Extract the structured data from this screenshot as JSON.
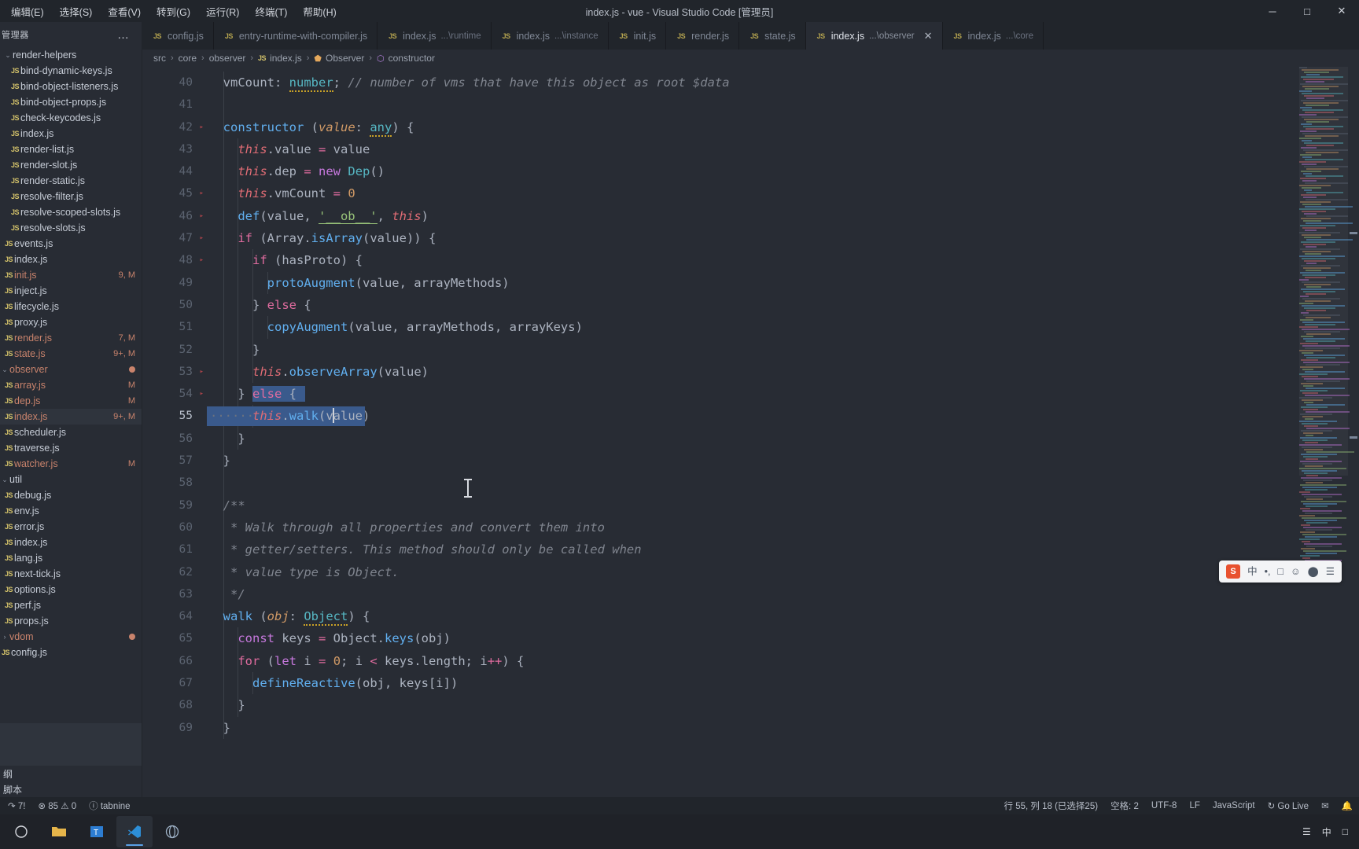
{
  "window": {
    "title": "index.js - vue - Visual Studio Code [管理员]",
    "menu": [
      "编辑(E)",
      "选择(S)",
      "查看(V)",
      "转到(G)",
      "运行(R)",
      "终端(T)",
      "帮助(H)"
    ],
    "controls": {
      "minimize": "─",
      "maximize": "□",
      "close": "✕"
    }
  },
  "sidebar": {
    "title": "管理器",
    "more_label": "…",
    "items": [
      {
        "label": "render-helpers",
        "type": "folder",
        "expanded": true,
        "indent": 1,
        "badge": ""
      },
      {
        "label": "bind-dynamic-keys.js",
        "type": "js",
        "indent": 2,
        "badge": ""
      },
      {
        "label": "bind-object-listeners.js",
        "type": "js",
        "indent": 2,
        "badge": ""
      },
      {
        "label": "bind-object-props.js",
        "type": "js",
        "indent": 2,
        "badge": ""
      },
      {
        "label": "check-keycodes.js",
        "type": "js",
        "indent": 2,
        "badge": ""
      },
      {
        "label": "index.js",
        "type": "js",
        "indent": 2,
        "badge": ""
      },
      {
        "label": "render-list.js",
        "type": "js",
        "indent": 2,
        "badge": ""
      },
      {
        "label": "render-slot.js",
        "type": "js",
        "indent": 2,
        "badge": ""
      },
      {
        "label": "render-static.js",
        "type": "js",
        "indent": 2,
        "badge": ""
      },
      {
        "label": "resolve-filter.js",
        "type": "js",
        "indent": 2,
        "badge": ""
      },
      {
        "label": "resolve-scoped-slots.js",
        "type": "js",
        "indent": 2,
        "badge": ""
      },
      {
        "label": "resolve-slots.js",
        "type": "js",
        "indent": 2,
        "badge": ""
      },
      {
        "label": "events.js",
        "type": "js",
        "indent": 1,
        "badge": ""
      },
      {
        "label": "index.js",
        "type": "js",
        "indent": 1,
        "badge": ""
      },
      {
        "label": "init.js",
        "type": "js",
        "indent": 1,
        "badge": "9, M",
        "modified": true
      },
      {
        "label": "inject.js",
        "type": "js",
        "indent": 1,
        "badge": ""
      },
      {
        "label": "lifecycle.js",
        "type": "js",
        "indent": 1,
        "badge": ""
      },
      {
        "label": "proxy.js",
        "type": "js",
        "indent": 1,
        "badge": ""
      },
      {
        "label": "render.js",
        "type": "js",
        "indent": 1,
        "badge": "7, M",
        "modified": true
      },
      {
        "label": "state.js",
        "type": "js",
        "indent": 1,
        "badge": "9+, M",
        "modified": true
      },
      {
        "label": "observer",
        "type": "folder",
        "expanded": true,
        "indent": 0,
        "badge": "dot",
        "modified": true
      },
      {
        "label": "array.js",
        "type": "js",
        "indent": 1,
        "badge": "M",
        "modified": true
      },
      {
        "label": "dep.js",
        "type": "js",
        "indent": 1,
        "badge": "M",
        "modified": true
      },
      {
        "label": "index.js",
        "type": "js",
        "indent": 1,
        "badge": "9+, M",
        "modified": true,
        "selected": true
      },
      {
        "label": "scheduler.js",
        "type": "js",
        "indent": 1,
        "badge": ""
      },
      {
        "label": "traverse.js",
        "type": "js",
        "indent": 1,
        "badge": ""
      },
      {
        "label": "watcher.js",
        "type": "js",
        "indent": 1,
        "badge": "M",
        "modified": true
      },
      {
        "label": "util",
        "type": "folder",
        "expanded": true,
        "indent": 0,
        "badge": ""
      },
      {
        "label": "debug.js",
        "type": "js",
        "indent": 1,
        "badge": ""
      },
      {
        "label": "env.js",
        "type": "js",
        "indent": 1,
        "badge": ""
      },
      {
        "label": "error.js",
        "type": "js",
        "indent": 1,
        "badge": ""
      },
      {
        "label": "index.js",
        "type": "js",
        "indent": 1,
        "badge": ""
      },
      {
        "label": "lang.js",
        "type": "js",
        "indent": 1,
        "badge": ""
      },
      {
        "label": "next-tick.js",
        "type": "js",
        "indent": 1,
        "badge": ""
      },
      {
        "label": "options.js",
        "type": "js",
        "indent": 1,
        "badge": ""
      },
      {
        "label": "perf.js",
        "type": "js",
        "indent": 1,
        "badge": ""
      },
      {
        "label": "props.js",
        "type": "js",
        "indent": 1,
        "badge": ""
      },
      {
        "label": "vdom",
        "type": "folder",
        "expanded": false,
        "indent": 0,
        "badge": "dot",
        "modified": true
      },
      {
        "label": "config.js",
        "type": "js",
        "indent": 0,
        "badge": ""
      }
    ],
    "bottom_sections": [
      "纲",
      "脚本"
    ]
  },
  "tabs": [
    {
      "label": "config.js",
      "sub": "",
      "active": false
    },
    {
      "label": "entry-runtime-with-compiler.js",
      "sub": "",
      "active": false
    },
    {
      "label": "index.js",
      "sub": "...\\runtime",
      "active": false
    },
    {
      "label": "index.js",
      "sub": "...\\instance",
      "active": false
    },
    {
      "label": "init.js",
      "sub": "",
      "active": false
    },
    {
      "label": "render.js",
      "sub": "",
      "active": false
    },
    {
      "label": "state.js",
      "sub": "",
      "active": false
    },
    {
      "label": "index.js",
      "sub": "...\\observer",
      "active": true,
      "close": "✕"
    },
    {
      "label": "index.js",
      "sub": "...\\core",
      "active": false
    }
  ],
  "breadcrumb": [
    {
      "label": "src",
      "icon": ""
    },
    {
      "label": "core",
      "icon": ""
    },
    {
      "label": "observer",
      "icon": ""
    },
    {
      "label": "index.js",
      "icon": "js-icon"
    },
    {
      "label": "Observer",
      "icon": "class-icon"
    },
    {
      "label": "constructor",
      "icon": "method-icon"
    }
  ],
  "editor": {
    "first_line": 40,
    "current_line": 55,
    "lines": [
      {
        "n": 40,
        "fold": false,
        "indent": 1,
        "tokens": [
          {
            "t": "  ",
            "c": "plain"
          },
          {
            "t": "vmCount",
            "c": "prop"
          },
          {
            "t": ": ",
            "c": "punct"
          },
          {
            "t": "number",
            "c": "type",
            "squiggle": true
          },
          {
            "t": "; ",
            "c": "punct"
          },
          {
            "t": "// number of vms that have this object as root $data",
            "c": "cmt"
          }
        ]
      },
      {
        "n": 41,
        "fold": false,
        "indent": 1,
        "tokens": []
      },
      {
        "n": 42,
        "fold": true,
        "indent": 1,
        "tokens": [
          {
            "t": "  ",
            "c": "plain"
          },
          {
            "t": "constructor",
            "c": "fnname"
          },
          {
            "t": " (",
            "c": "punct"
          },
          {
            "t": "value",
            "c": "param"
          },
          {
            "t": ": ",
            "c": "punct"
          },
          {
            "t": "any",
            "c": "type",
            "squiggle": true
          },
          {
            "t": ") {",
            "c": "punct"
          }
        ]
      },
      {
        "n": 43,
        "fold": false,
        "indent": 2,
        "tokens": [
          {
            "t": "    ",
            "c": "plain"
          },
          {
            "t": "this",
            "c": "var"
          },
          {
            "t": ".value ",
            "c": "prop"
          },
          {
            "t": "=",
            "c": "kw2"
          },
          {
            "t": " value",
            "c": "prop"
          }
        ]
      },
      {
        "n": 44,
        "fold": false,
        "indent": 2,
        "tokens": [
          {
            "t": "    ",
            "c": "plain"
          },
          {
            "t": "this",
            "c": "var"
          },
          {
            "t": ".dep ",
            "c": "prop"
          },
          {
            "t": "=",
            "c": "kw2"
          },
          {
            "t": " ",
            "c": "plain"
          },
          {
            "t": "new",
            "c": "kw"
          },
          {
            "t": " ",
            "c": "plain"
          },
          {
            "t": "Dep",
            "c": "type"
          },
          {
            "t": "()",
            "c": "punct"
          }
        ]
      },
      {
        "n": 45,
        "fold": true,
        "indent": 2,
        "tokens": [
          {
            "t": "    ",
            "c": "plain"
          },
          {
            "t": "this",
            "c": "var"
          },
          {
            "t": ".vmCount ",
            "c": "prop"
          },
          {
            "t": "=",
            "c": "kw2"
          },
          {
            "t": " ",
            "c": "plain"
          },
          {
            "t": "0",
            "c": "num"
          }
        ]
      },
      {
        "n": 46,
        "fold": true,
        "indent": 2,
        "tokens": [
          {
            "t": "    ",
            "c": "plain"
          },
          {
            "t": "def",
            "c": "fn"
          },
          {
            "t": "(value, ",
            "c": "punct"
          },
          {
            "t": "'__ob__'",
            "c": "str",
            "underline": true
          },
          {
            "t": ", ",
            "c": "punct"
          },
          {
            "t": "this",
            "c": "var"
          },
          {
            "t": ")",
            "c": "punct"
          }
        ]
      },
      {
        "n": 47,
        "fold": true,
        "indent": 2,
        "tokens": [
          {
            "t": "    ",
            "c": "plain"
          },
          {
            "t": "if",
            "c": "kw2"
          },
          {
            "t": " (Array.",
            "c": "punct"
          },
          {
            "t": "isArray",
            "c": "fn"
          },
          {
            "t": "(value)) {",
            "c": "punct"
          }
        ]
      },
      {
        "n": 48,
        "fold": true,
        "indent": 3,
        "tokens": [
          {
            "t": "      ",
            "c": "plain"
          },
          {
            "t": "if",
            "c": "kw2"
          },
          {
            "t": " (hasProto) {",
            "c": "punct"
          }
        ]
      },
      {
        "n": 49,
        "fold": false,
        "indent": 4,
        "tokens": [
          {
            "t": "        ",
            "c": "plain"
          },
          {
            "t": "protoAugment",
            "c": "fn"
          },
          {
            "t": "(value, arrayMethods)",
            "c": "punct"
          }
        ]
      },
      {
        "n": 50,
        "fold": false,
        "indent": 3,
        "tokens": [
          {
            "t": "      } ",
            "c": "punct"
          },
          {
            "t": "else",
            "c": "kw2"
          },
          {
            "t": " {",
            "c": "punct"
          }
        ]
      },
      {
        "n": 51,
        "fold": false,
        "indent": 4,
        "tokens": [
          {
            "t": "        ",
            "c": "plain"
          },
          {
            "t": "copyAugment",
            "c": "fn"
          },
          {
            "t": "(value, arrayMethods, arrayKeys)",
            "c": "punct"
          }
        ]
      },
      {
        "n": 52,
        "fold": false,
        "indent": 3,
        "tokens": [
          {
            "t": "      }",
            "c": "punct"
          }
        ]
      },
      {
        "n": 53,
        "fold": true,
        "indent": 3,
        "tokens": [
          {
            "t": "      ",
            "c": "plain"
          },
          {
            "t": "this",
            "c": "var"
          },
          {
            "t": ".",
            "c": "punct"
          },
          {
            "t": "observeArray",
            "c": "fn"
          },
          {
            "t": "(value)",
            "c": "punct"
          }
        ]
      },
      {
        "n": 54,
        "fold": true,
        "indent": 2,
        "selstart": 6,
        "tokens": [
          {
            "t": "    } ",
            "c": "punct"
          },
          {
            "t": "else",
            "c": "kw2"
          },
          {
            "t": " {",
            "c": "punct"
          }
        ]
      },
      {
        "n": 55,
        "fold": false,
        "indent": 3,
        "current": true,
        "tokens": [
          {
            "t": "      ",
            "c": "plain"
          },
          {
            "t": "this",
            "c": "var"
          },
          {
            "t": ".",
            "c": "punct"
          },
          {
            "t": "walk",
            "c": "fn"
          },
          {
            "t": "(v",
            "c": "punct"
          },
          {
            "t": "CURSOR",
            "c": "cursor"
          },
          {
            "t": "alue)",
            "c": "punct"
          }
        ]
      },
      {
        "n": 56,
        "fold": false,
        "indent": 2,
        "tokens": [
          {
            "t": "    }",
            "c": "punct"
          }
        ]
      },
      {
        "n": 57,
        "fold": false,
        "indent": 1,
        "tokens": [
          {
            "t": "  }",
            "c": "punct"
          }
        ]
      },
      {
        "n": 58,
        "fold": false,
        "indent": 1,
        "tokens": []
      },
      {
        "n": 59,
        "fold": false,
        "indent": 1,
        "tokens": [
          {
            "t": "  /**",
            "c": "cmt"
          }
        ]
      },
      {
        "n": 60,
        "fold": false,
        "indent": 1,
        "tokens": [
          {
            "t": "   * Walk through all properties and convert them into",
            "c": "cmt"
          }
        ]
      },
      {
        "n": 61,
        "fold": false,
        "indent": 1,
        "tokens": [
          {
            "t": "   * getter/setters. This method should only be called when",
            "c": "cmt"
          }
        ]
      },
      {
        "n": 62,
        "fold": false,
        "indent": 1,
        "tokens": [
          {
            "t": "   * value type is Object.",
            "c": "cmt"
          }
        ]
      },
      {
        "n": 63,
        "fold": false,
        "indent": 1,
        "tokens": [
          {
            "t": "   */",
            "c": "cmt"
          }
        ]
      },
      {
        "n": 64,
        "fold": false,
        "indent": 1,
        "tokens": [
          {
            "t": "  ",
            "c": "plain"
          },
          {
            "t": "walk",
            "c": "fnname"
          },
          {
            "t": " (",
            "c": "punct"
          },
          {
            "t": "obj",
            "c": "param"
          },
          {
            "t": ": ",
            "c": "punct"
          },
          {
            "t": "Object",
            "c": "type",
            "squiggle": true
          },
          {
            "t": ") {",
            "c": "punct"
          }
        ]
      },
      {
        "n": 65,
        "fold": false,
        "indent": 2,
        "tokens": [
          {
            "t": "    ",
            "c": "plain"
          },
          {
            "t": "const",
            "c": "kw"
          },
          {
            "t": " keys ",
            "c": "prop"
          },
          {
            "t": "=",
            "c": "kw2"
          },
          {
            "t": " Object.",
            "c": "punct"
          },
          {
            "t": "keys",
            "c": "fn"
          },
          {
            "t": "(obj)",
            "c": "punct"
          }
        ]
      },
      {
        "n": 66,
        "fold": false,
        "indent": 2,
        "tokens": [
          {
            "t": "    ",
            "c": "plain"
          },
          {
            "t": "for",
            "c": "kw2"
          },
          {
            "t": " (",
            "c": "punct"
          },
          {
            "t": "let",
            "c": "kw"
          },
          {
            "t": " i ",
            "c": "punct"
          },
          {
            "t": "=",
            "c": "kw2"
          },
          {
            "t": " ",
            "c": "plain"
          },
          {
            "t": "0",
            "c": "num"
          },
          {
            "t": "; i ",
            "c": "punct"
          },
          {
            "t": "<",
            "c": "kw2"
          },
          {
            "t": " keys.length; i",
            "c": "punct"
          },
          {
            "t": "++",
            "c": "kw2"
          },
          {
            "t": ") {",
            "c": "punct"
          }
        ]
      },
      {
        "n": 67,
        "fold": false,
        "indent": 3,
        "tokens": [
          {
            "t": "      ",
            "c": "plain"
          },
          {
            "t": "defineReactive",
            "c": "fn"
          },
          {
            "t": "(obj, keys[i])",
            "c": "punct"
          }
        ]
      },
      {
        "n": 68,
        "fold": false,
        "indent": 2,
        "tokens": [
          {
            "t": "    }",
            "c": "punct"
          }
        ]
      },
      {
        "n": 69,
        "fold": false,
        "indent": 1,
        "tokens": [
          {
            "t": "  }",
            "c": "punct"
          }
        ]
      }
    ]
  },
  "ime": {
    "logo": "S",
    "items": [
      "中",
      "•,",
      "□",
      "☺",
      "⬤",
      "☰"
    ]
  },
  "statusbar": {
    "left": [
      {
        "label": "↷ 7!",
        "name": "remote-indicator"
      },
      {
        "label": "⊗ 85  ⚠ 0",
        "name": "problems"
      },
      {
        "label": "ⓘ tabnine",
        "name": "tabnine"
      }
    ],
    "right": [
      {
        "label": "行 55, 列 18 (已选择25)",
        "name": "cursor-position"
      },
      {
        "label": "空格: 2",
        "name": "indentation"
      },
      {
        "label": "UTF-8",
        "name": "encoding"
      },
      {
        "label": "LF",
        "name": "eol"
      },
      {
        "label": "JavaScript",
        "name": "language-mode"
      },
      {
        "label": "↻ Go Live",
        "name": "go-live"
      },
      {
        "label": "✉",
        "name": "feedback"
      },
      {
        "label": "🔔",
        "name": "notifications"
      }
    ]
  },
  "taskbar": {
    "buttons": [
      {
        "name": "start-button",
        "glyph": "⬜"
      },
      {
        "name": "file-explorer",
        "glyph": "📁"
      },
      {
        "name": "terminal-app",
        "glyph": "T"
      },
      {
        "name": "vscode-app",
        "glyph": "⬚",
        "active": true
      },
      {
        "name": "browser-app",
        "glyph": "●"
      }
    ],
    "tray": [
      "☰",
      "中",
      "□"
    ]
  }
}
